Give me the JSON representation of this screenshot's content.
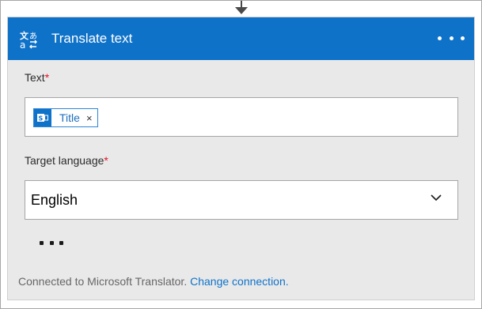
{
  "card": {
    "title": "Translate text",
    "icon": "translate-icon",
    "more_icon": "more-options-icon"
  },
  "text_field": {
    "label": "Text",
    "required_mark": "*",
    "token": {
      "label": "Title",
      "remove": "×",
      "icon": "sharepoint-icon"
    }
  },
  "target_language": {
    "label": "Target language",
    "required_mark": "*",
    "value": "English",
    "chevron_icon": "chevron-down-icon"
  },
  "advanced_icon": "ellipsis-icon",
  "footer": {
    "text": "Connected to Microsoft Translator.",
    "link": "Change connection."
  },
  "colors": {
    "header": "#0f72c9",
    "required": "#e81123",
    "link": "#0f72c9"
  }
}
